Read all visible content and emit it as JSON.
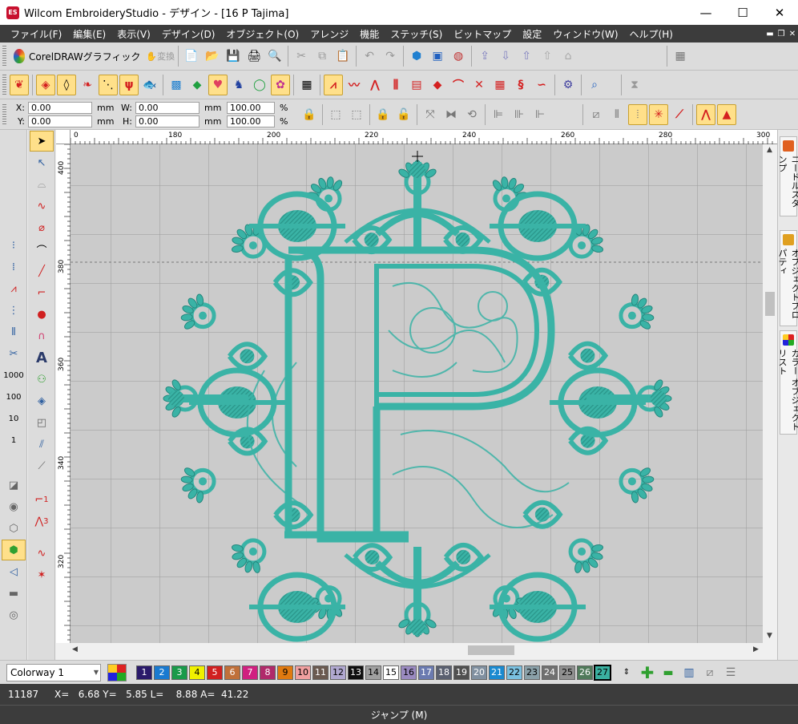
{
  "window": {
    "title": "Wilcom EmbroideryStudio - デザイン - [16  P        Tajima]",
    "app_icon": "ES",
    "minimize": "—",
    "maximize": "☐",
    "close": "✕"
  },
  "menu": {
    "items": [
      "ファイル(F)",
      "編集(E)",
      "表示(V)",
      "デザイン(D)",
      "オブジェクト(O)",
      "アレンジ",
      "機能",
      "ステッチ(S)",
      "ビットマップ",
      "設定",
      "ウィンドウ(W)",
      "ヘルプ(H)"
    ],
    "mdi_min": "▬",
    "mdi_restore": "❐",
    "mdi_close": "✕"
  },
  "toolbar_top": {
    "corel_label": "CorelDRAWグラフィック",
    "convert_label": "変換"
  },
  "fields": {
    "x_label": "X:",
    "x_value": "0.00",
    "y_label": "Y:",
    "y_value": "0.00",
    "w_label": "W:",
    "w_value": "0.00",
    "h_label": "H:",
    "h_value": "0.00",
    "unit": "mm",
    "sx_value": "100.00",
    "sy_value": "100.00",
    "percent": "%"
  },
  "ruler": {
    "h_labels": [
      "0",
      "180",
      "200",
      "220",
      "240",
      "260",
      "280",
      "300"
    ],
    "v_labels": [
      "400",
      "380",
      "360",
      "340",
      "320"
    ]
  },
  "left_tools": {
    "counts": [
      "1000",
      "100",
      "10",
      "1"
    ],
    "step_1": "1",
    "step_3": "3"
  },
  "docker": {
    "tab1": "ニードルスタンプ",
    "tab2": "オブジェクトプロパティ",
    "tab3": "カラー オブジェクトリスト"
  },
  "colorway": {
    "value": "Colorway 1",
    "swatches": [
      {
        "n": "1",
        "c": "#2a1a6a",
        "fg": "#fff"
      },
      {
        "n": "2",
        "c": "#1a7ad0",
        "fg": "#fff"
      },
      {
        "n": "3",
        "c": "#1a9a4a",
        "fg": "#fff"
      },
      {
        "n": "4",
        "c": "#f0f000",
        "fg": "#000"
      },
      {
        "n": "5",
        "c": "#d02020",
        "fg": "#fff"
      },
      {
        "n": "6",
        "c": "#c0703a",
        "fg": "#fff"
      },
      {
        "n": "7",
        "c": "#d02080",
        "fg": "#fff"
      },
      {
        "n": "8",
        "c": "#b02a6a",
        "fg": "#fff"
      },
      {
        "n": "9",
        "c": "#e07a10",
        "fg": "#000"
      },
      {
        "n": "10",
        "c": "#f0a0a0",
        "fg": "#000"
      },
      {
        "n": "11",
        "c": "#6a5a50",
        "fg": "#fff"
      },
      {
        "n": "12",
        "c": "#b0a8d0",
        "fg": "#000"
      },
      {
        "n": "13",
        "c": "#101010",
        "fg": "#fff"
      },
      {
        "n": "14",
        "c": "#a0a0a0",
        "fg": "#000"
      },
      {
        "n": "15",
        "c": "#ffffff",
        "fg": "#000"
      },
      {
        "n": "16",
        "c": "#9a8ac0",
        "fg": "#000"
      },
      {
        "n": "17",
        "c": "#6a7ab0",
        "fg": "#fff"
      },
      {
        "n": "18",
        "c": "#5a6070",
        "fg": "#fff"
      },
      {
        "n": "19",
        "c": "#505050",
        "fg": "#fff"
      },
      {
        "n": "20",
        "c": "#8090a0",
        "fg": "#fff"
      },
      {
        "n": "21",
        "c": "#1a8ad0",
        "fg": "#fff"
      },
      {
        "n": "22",
        "c": "#7ac0e0",
        "fg": "#000"
      },
      {
        "n": "23",
        "c": "#8aa0a8",
        "fg": "#000"
      },
      {
        "n": "24",
        "c": "#707070",
        "fg": "#fff"
      },
      {
        "n": "25",
        "c": "#909090",
        "fg": "#000"
      },
      {
        "n": "26",
        "c": "#507a5a",
        "fg": "#fff"
      },
      {
        "n": "27",
        "c": "#3ab0a0",
        "fg": "#000"
      }
    ],
    "selected": "27"
  },
  "status": {
    "stitch_count": "11187",
    "coords": "X=   6.68 Y=   5.85 L=    8.88 A=  41.22"
  },
  "bottom": {
    "mode": "ジャンプ (M)"
  },
  "colors": {
    "thread": "#3ab3a6",
    "thread_dark": "#23877d",
    "canvas_bg": "#cbcbcb"
  }
}
